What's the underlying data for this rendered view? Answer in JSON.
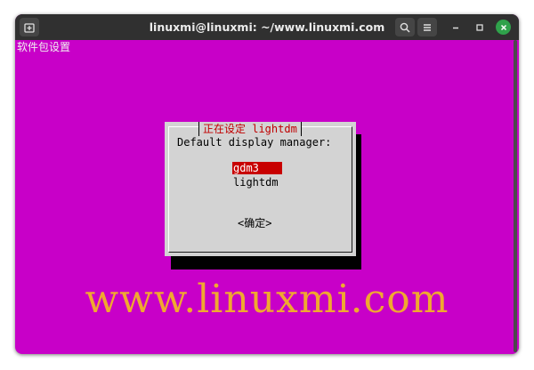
{
  "window": {
    "title": "linuxmi@linuxmi: ~/www.linuxmi.com",
    "new_tab_icon": "new-tab-icon",
    "search_icon": "search-icon",
    "menu_icon": "hamburger-menu-icon",
    "minimize_icon": "minimize-icon",
    "maximize_icon": "maximize-icon",
    "close_icon": "close-icon",
    "close_color": "#2fa24b"
  },
  "terminal": {
    "background": "#c800c8",
    "top_text": "软件包设置"
  },
  "dialog": {
    "title": "正在设定 lightdm",
    "prompt": "Default display manager:",
    "options": [
      {
        "label": "gdm3",
        "selected": true
      },
      {
        "label": "lightdm",
        "selected": false
      }
    ],
    "ok_label": "<确定>",
    "title_color": "#c00000",
    "selection_color": "#c80000"
  },
  "watermark": {
    "text": "www.linuxmi.com",
    "color": "#f0a830"
  }
}
